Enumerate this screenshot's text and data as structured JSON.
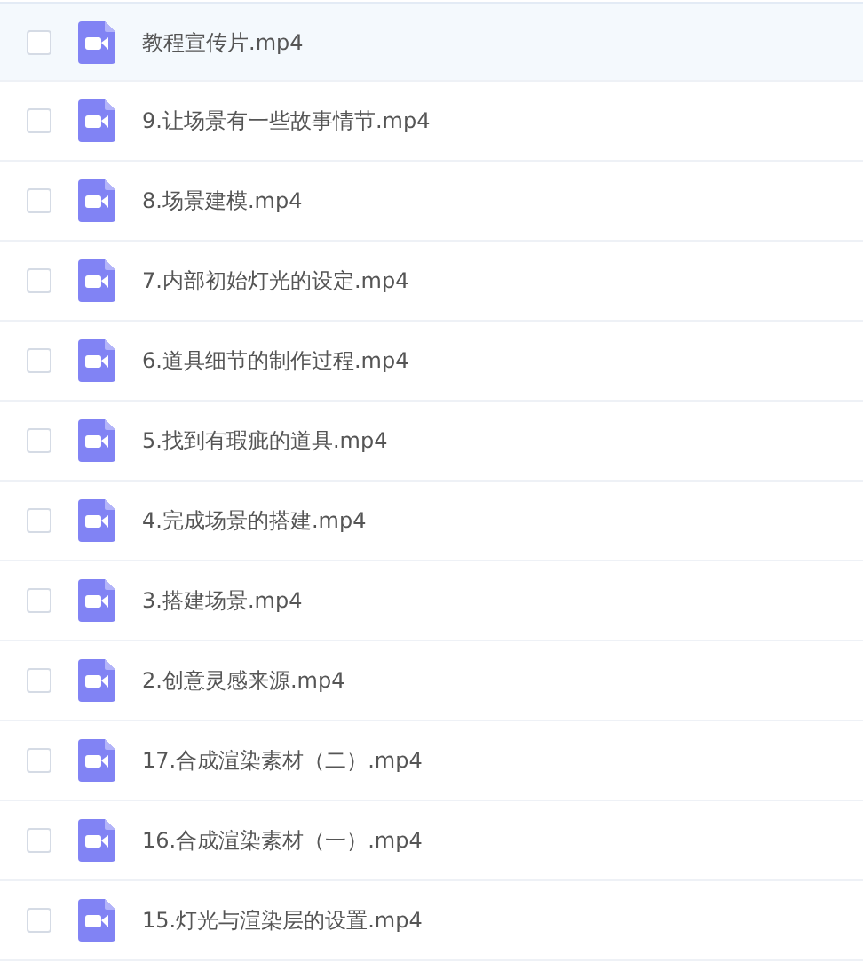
{
  "files": [
    {
      "name": "教程宣传片.mp4",
      "checked": false,
      "selected": true
    },
    {
      "name": "9.让场景有一些故事情节.mp4",
      "checked": false,
      "selected": false
    },
    {
      "name": "8.场景建模.mp4",
      "checked": false,
      "selected": false
    },
    {
      "name": "7.内部初始灯光的设定.mp4",
      "checked": false,
      "selected": false
    },
    {
      "name": "6.道具细节的制作过程.mp4",
      "checked": false,
      "selected": false
    },
    {
      "name": "5.找到有瑕疵的道具.mp4",
      "checked": false,
      "selected": false
    },
    {
      "name": "4.完成场景的搭建.mp4",
      "checked": false,
      "selected": false
    },
    {
      "name": "3.搭建场景.mp4",
      "checked": false,
      "selected": false
    },
    {
      "name": "2.创意灵感来源.mp4",
      "checked": false,
      "selected": false
    },
    {
      "name": "17.合成渲染素材（二）.mp4",
      "checked": false,
      "selected": false
    },
    {
      "name": "16.合成渲染素材（一）.mp4",
      "checked": false,
      "selected": false
    },
    {
      "name": "15.灯光与渲染层的设置.mp4",
      "checked": false,
      "selected": false
    }
  ]
}
